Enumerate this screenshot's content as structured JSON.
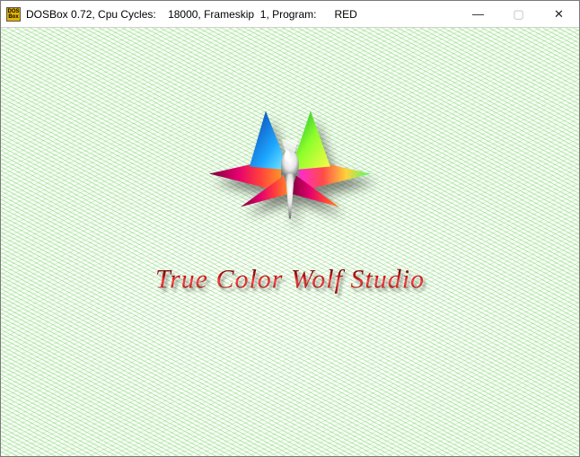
{
  "window": {
    "icon_text": "DOS\nBox",
    "title": "DOSBox 0.72, Cpu Cycles:    18000, Frameskip  1, Program:      RED",
    "controls": {
      "minimize": "—",
      "maximize": "▢",
      "close": "✕"
    }
  },
  "splash": {
    "title": "True Color Wolf Studio"
  }
}
